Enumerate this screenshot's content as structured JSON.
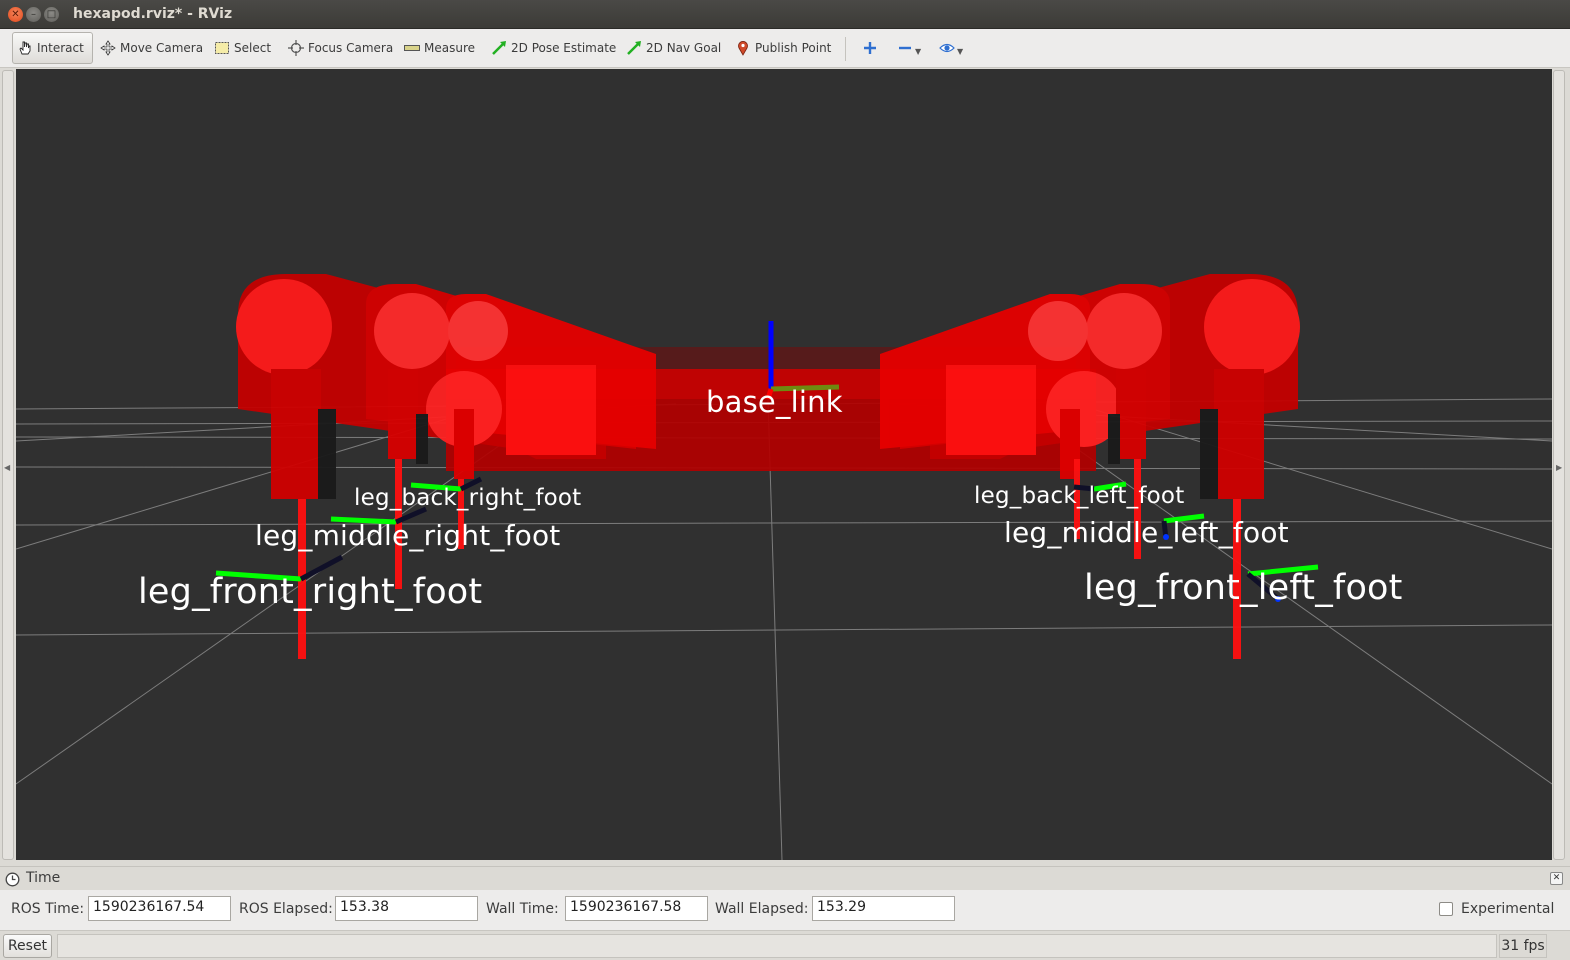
{
  "window": {
    "title": "hexapod.rviz* - RViz"
  },
  "toolbar": {
    "interact": "Interact",
    "move_camera": "Move Camera",
    "select": "Select",
    "focus_camera": "Focus Camera",
    "measure": "Measure",
    "pose_estimate": "2D Pose Estimate",
    "nav_goal": "2D Nav Goal",
    "publish_point": "Publish Point"
  },
  "viewport": {
    "background": "#303030",
    "grid_color": "#8a8a8a",
    "robot_color": "#ff0000",
    "frames": {
      "base_link": "base_link",
      "leg_back_right_foot": "leg_back_right_foot",
      "leg_middle_right_foot": "leg_middle_right_foot",
      "leg_front_right_foot": "leg_front_right_foot",
      "leg_back_left_foot": "leg_back_left_foot",
      "leg_middle_left_foot": "leg_middle_left_foot",
      "leg_front_left_foot": "leg_front_left_foot"
    }
  },
  "time_panel": {
    "title": "Time",
    "ros_time_label": "ROS Time:",
    "ros_time": "1590236167.54",
    "ros_elapsed_label": "ROS Elapsed:",
    "ros_elapsed": "153.38",
    "wall_time_label": "Wall Time:",
    "wall_time": "1590236167.58",
    "wall_elapsed_label": "Wall Elapsed:",
    "wall_elapsed": "153.29",
    "experimental_label": "Experimental",
    "experimental_checked": false
  },
  "status": {
    "reset": "Reset",
    "fps": "31 fps"
  }
}
